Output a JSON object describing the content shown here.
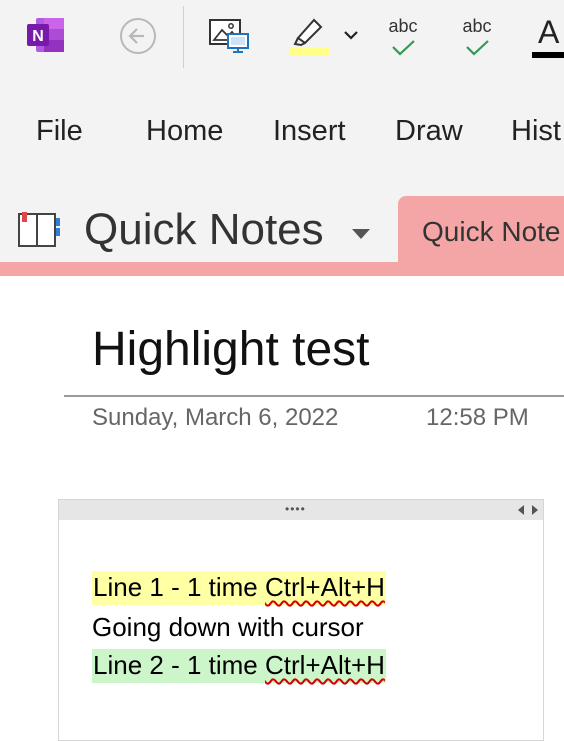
{
  "toolbar": {
    "app_icon_letter": "N",
    "spell_check_1": "abc",
    "spell_check_2": "abc",
    "font_color_letter": "A"
  },
  "ribbon": {
    "tabs": [
      {
        "label": "File"
      },
      {
        "label": "Home"
      },
      {
        "label": "Insert"
      },
      {
        "label": "Draw"
      },
      {
        "label": "Hist"
      }
    ]
  },
  "notebook": {
    "title": "Quick Notes",
    "section_tab": "Quick Note"
  },
  "page": {
    "title": "Highlight test",
    "date": "Sunday, March 6, 2022",
    "time": "12:58 PM"
  },
  "note": {
    "handle": "••••",
    "lines": [
      {
        "prefix": "Line 1 - 1 time ",
        "squiggled": "Ctrl+Alt+H",
        "highlight": "#ffffa3"
      },
      {
        "prefix": "Going down with cursor",
        "squiggled": "",
        "highlight": ""
      },
      {
        "prefix": "Line 2 - 1 time ",
        "squiggled": "Ctrl+Alt+H",
        "highlight": "#ccf5c9"
      }
    ]
  },
  "colors": {
    "onenote_purple": "#7719aa",
    "section_color": "#f4a6a6",
    "spell_check_green": "#2e9b4e",
    "highlighter_yellow": "#ffff8a"
  },
  "icons": {
    "app": "onenote-icon",
    "back": "back-arrow-icon",
    "screen_clipping": "screen-clipping-icon",
    "highlighter": "highlighter-icon",
    "dropdown": "chevron-down-icon",
    "spelling": "spell-check-icon",
    "font_color": "font-color-icon",
    "notebook": "notebook-icon"
  }
}
